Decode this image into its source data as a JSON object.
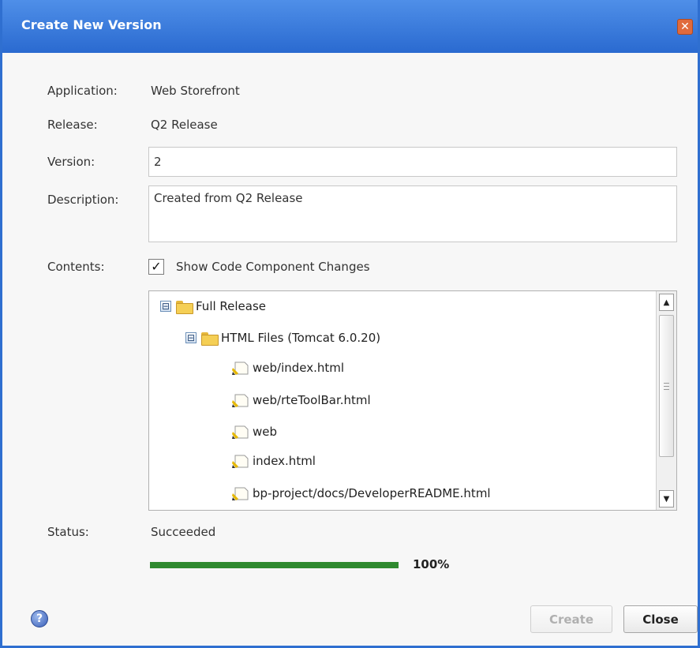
{
  "dialog": {
    "title": "Create New Version",
    "close_glyph": "✕"
  },
  "form": {
    "application_label": "Application:",
    "application_value": "Web Storefront",
    "release_label": "Release:",
    "release_value": "Q2 Release",
    "version_label": "Version:",
    "version_value": "2",
    "description_label": "Description:",
    "description_value": "Created from Q2 Release",
    "contents_label": "Contents:",
    "show_changes_label": "Show Code Component Changes",
    "show_changes_checked": true,
    "check_glyph": "✓"
  },
  "tree": {
    "toggle_glyph": "⊟",
    "root": "Full Release",
    "group": "HTML Files (Tomcat 6.0.20)",
    "files": [
      "web/index.html",
      "web/rteToolBar.html",
      "web",
      "index.html",
      "bp-project/docs/DeveloperREADME.html"
    ],
    "scroll_up_glyph": "▲",
    "scroll_down_glyph": "▼"
  },
  "status": {
    "label": "Status:",
    "value": "Succeeded",
    "progress_percent": 100,
    "progress_text": "100%"
  },
  "footer": {
    "help_glyph": "?",
    "create_label": "Create",
    "close_label": "Close"
  },
  "colors": {
    "titlebar": "#2a6ad0",
    "progress": "#2f8a2f"
  }
}
